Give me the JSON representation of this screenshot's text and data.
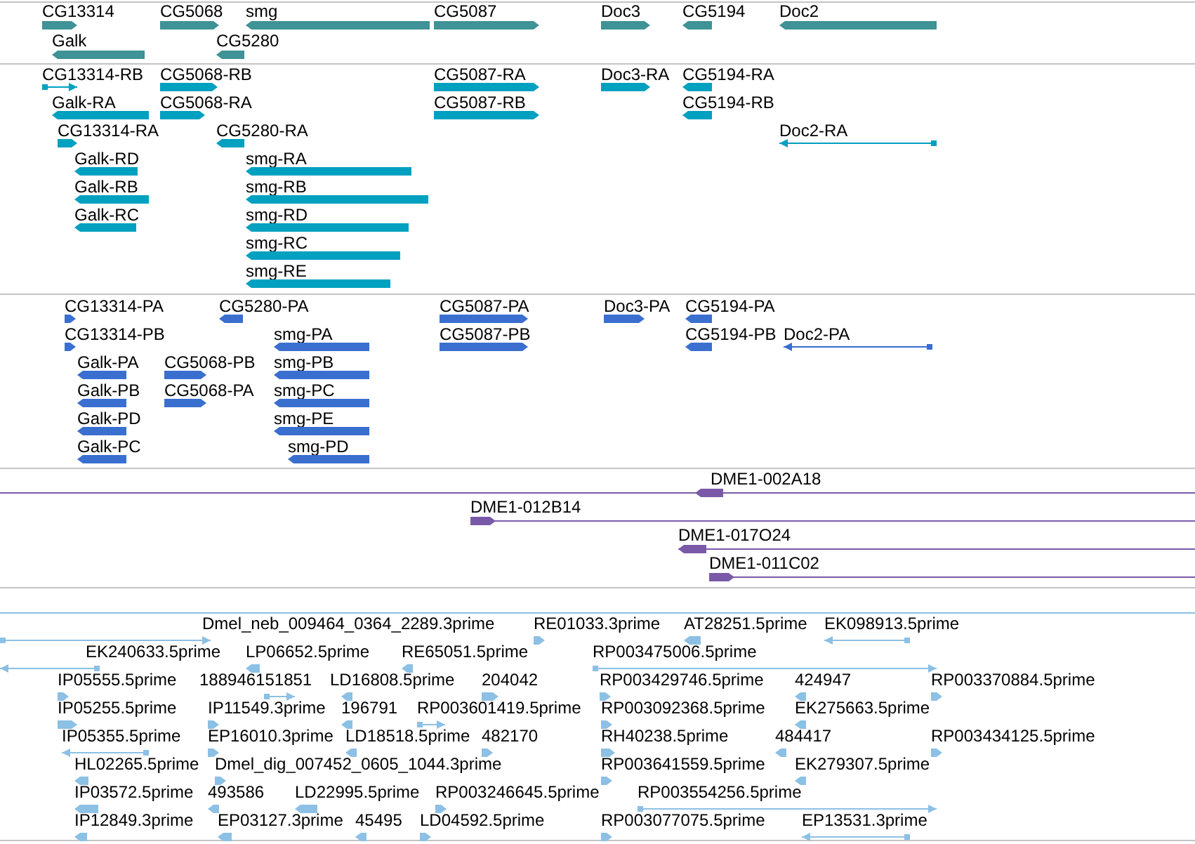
{
  "tracks": [
    {
      "kind": "genes",
      "features": [
        {
          "label": "CG13314",
          "reverse": false
        },
        {
          "label": "CG5068",
          "reverse": false
        },
        {
          "label": "smg",
          "reverse": true
        },
        {
          "label": "CG5087",
          "reverse": false
        },
        {
          "label": "Doc3",
          "reverse": false
        },
        {
          "label": "CG5194",
          "reverse": true
        },
        {
          "label": "Doc2",
          "reverse": true
        },
        {
          "label": "Galk",
          "reverse": true
        },
        {
          "label": "CG5280",
          "reverse": true
        }
      ]
    },
    {
      "kind": "transcripts",
      "features": [
        {
          "label": "CG13314-RB",
          "reverse": false
        },
        {
          "label": "CG5068-RB",
          "reverse": false
        },
        {
          "label": "CG5087-RA",
          "reverse": false
        },
        {
          "label": "Doc3-RA",
          "reverse": false
        },
        {
          "label": "CG5194-RA",
          "reverse": true
        },
        {
          "label": "Galk-RA",
          "reverse": true
        },
        {
          "label": "CG5068-RA",
          "reverse": false
        },
        {
          "label": "CG5087-RB",
          "reverse": false
        },
        {
          "label": "CG5194-RB",
          "reverse": true
        },
        {
          "label": "CG13314-RA",
          "reverse": false
        },
        {
          "label": "CG5280-RA",
          "reverse": true
        },
        {
          "label": "Doc2-RA",
          "reverse": true
        },
        {
          "label": "Galk-RD",
          "reverse": true
        },
        {
          "label": "smg-RA",
          "reverse": true
        },
        {
          "label": "Galk-RB",
          "reverse": true
        },
        {
          "label": "smg-RB",
          "reverse": true
        },
        {
          "label": "Galk-RC",
          "reverse": true
        },
        {
          "label": "smg-RD",
          "reverse": true
        },
        {
          "label": "smg-RC",
          "reverse": true
        },
        {
          "label": "smg-RE",
          "reverse": true
        }
      ]
    },
    {
      "kind": "proteins",
      "features": [
        {
          "label": "CG13314-PA",
          "reverse": false
        },
        {
          "label": "CG5280-PA",
          "reverse": true
        },
        {
          "label": "CG5087-PA",
          "reverse": false
        },
        {
          "label": "Doc3-PA",
          "reverse": false
        },
        {
          "label": "CG5194-PA",
          "reverse": true
        },
        {
          "label": "CG13314-PB",
          "reverse": false
        },
        {
          "label": "smg-PA",
          "reverse": true
        },
        {
          "label": "CG5087-PB",
          "reverse": false
        },
        {
          "label": "CG5194-PB",
          "reverse": true
        },
        {
          "label": "Doc2-PA",
          "reverse": true
        },
        {
          "label": "Galk-PA",
          "reverse": true
        },
        {
          "label": "CG5068-PB",
          "reverse": false
        },
        {
          "label": "smg-PB",
          "reverse": true
        },
        {
          "label": "Galk-PB",
          "reverse": true
        },
        {
          "label": "CG5068-PA",
          "reverse": false
        },
        {
          "label": "smg-PC",
          "reverse": true
        },
        {
          "label": "Galk-PD",
          "reverse": true
        },
        {
          "label": "smg-PE",
          "reverse": true
        },
        {
          "label": "Galk-PC",
          "reverse": true
        },
        {
          "label": "smg-PD",
          "reverse": true
        }
      ]
    },
    {
      "kind": "clones",
      "features": [
        {
          "label": "DME1-002A18",
          "reverse": true
        },
        {
          "label": "DME1-012B14",
          "reverse": false
        },
        {
          "label": "DME1-017O24",
          "reverse": true
        },
        {
          "label": "DME1-011C02",
          "reverse": false
        }
      ]
    },
    {
      "kind": "ests",
      "features": [
        {
          "label": "Dmel_neb_009464_0364_2289.3prime",
          "reverse": false
        },
        {
          "label": "RE01033.3prime",
          "reverse": false
        },
        {
          "label": "AT28251.5prime",
          "reverse": true
        },
        {
          "label": "EK098913.5prime",
          "reverse": true
        },
        {
          "label": "EK240633.5prime",
          "reverse": true
        },
        {
          "label": "LP06652.5prime",
          "reverse": true
        },
        {
          "label": "RE65051.5prime",
          "reverse": true
        },
        {
          "label": "RP003475006.5prime",
          "reverse": false
        },
        {
          "label": "IP05555.5prime",
          "reverse": false
        },
        {
          "label": "188946151851",
          "reverse": false
        },
        {
          "label": "LD16808.5prime",
          "reverse": true
        },
        {
          "label": "204042",
          "reverse": false
        },
        {
          "label": "RP003429746.5prime",
          "reverse": false
        },
        {
          "label": "424947",
          "reverse": true
        },
        {
          "label": "RP003370884.5prime",
          "reverse": false
        },
        {
          "label": "IP05255.5prime",
          "reverse": false
        },
        {
          "label": "IP11549.3prime",
          "reverse": false
        },
        {
          "label": "196791",
          "reverse": true
        },
        {
          "label": "RP003601419.5prime",
          "reverse": false
        },
        {
          "label": "RP003092368.5prime",
          "reverse": false
        },
        {
          "label": "EK275663.5prime",
          "reverse": true
        },
        {
          "label": "IP05355.5prime",
          "reverse": true
        },
        {
          "label": "EP16010.3prime",
          "reverse": false
        },
        {
          "label": "LD18518.5prime",
          "reverse": true
        },
        {
          "label": "482170",
          "reverse": false
        },
        {
          "label": "RH40238.5prime",
          "reverse": false
        },
        {
          "label": "484417",
          "reverse": true
        },
        {
          "label": "RP003434125.5prime",
          "reverse": false
        },
        {
          "label": "HL02265.5prime",
          "reverse": true
        },
        {
          "label": "Dmel_dig_007452_0605_1044.3prime",
          "reverse": false
        },
        {
          "label": "RP003641559.5prime",
          "reverse": false
        },
        {
          "label": "EK279307.5prime",
          "reverse": true
        },
        {
          "label": "IP03572.5prime",
          "reverse": true
        },
        {
          "label": "493586",
          "reverse": true
        },
        {
          "label": "LD22995.5prime",
          "reverse": true
        },
        {
          "label": "RP003246645.5prime",
          "reverse": false
        },
        {
          "label": "RP003554256.5prime",
          "reverse": false
        },
        {
          "label": "IP12849.3prime",
          "reverse": true
        },
        {
          "label": "EP03127.3prime",
          "reverse": true
        },
        {
          "label": "45495",
          "reverse": true
        },
        {
          "label": "LD04592.5prime",
          "reverse": false
        },
        {
          "label": "RP003077075.5prime",
          "reverse": false
        },
        {
          "label": "EP13531.3prime",
          "reverse": true
        }
      ]
    }
  ]
}
